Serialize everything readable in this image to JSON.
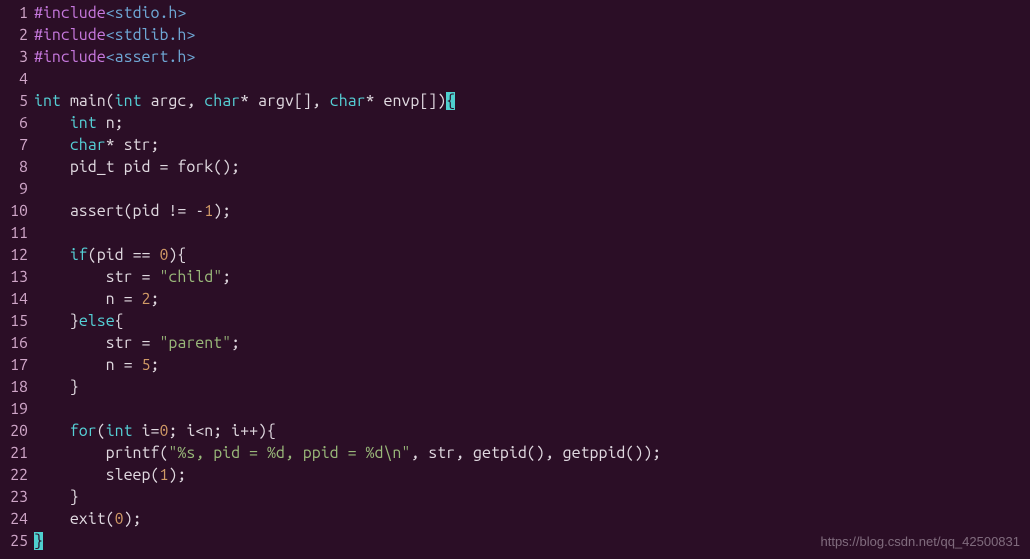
{
  "watermark": "https://blog.csdn.net/qq_42500831",
  "lines": [
    {
      "n": "1",
      "tokens": [
        {
          "t": "#include",
          "c": "pp"
        },
        {
          "t": "<stdio.h>",
          "c": "hdr"
        }
      ]
    },
    {
      "n": "2",
      "tokens": [
        {
          "t": "#include",
          "c": "pp"
        },
        {
          "t": "<stdlib.h>",
          "c": "hdr"
        }
      ]
    },
    {
      "n": "3",
      "tokens": [
        {
          "t": "#include",
          "c": "pp"
        },
        {
          "t": "<assert.h>",
          "c": "hdr"
        }
      ]
    },
    {
      "n": "4",
      "tokens": []
    },
    {
      "n": "5",
      "tokens": [
        {
          "t": "int",
          "c": "kw"
        },
        {
          "t": " main(",
          "c": "id"
        },
        {
          "t": "int",
          "c": "kw"
        },
        {
          "t": " argc, ",
          "c": "id"
        },
        {
          "t": "char",
          "c": "kw"
        },
        {
          "t": "* argv[], ",
          "c": "id"
        },
        {
          "t": "char",
          "c": "kw"
        },
        {
          "t": "* envp[])",
          "c": "id"
        },
        {
          "t": "{",
          "c": "cursor"
        }
      ]
    },
    {
      "n": "6",
      "tokens": [
        {
          "t": "    ",
          "c": "id"
        },
        {
          "t": "int",
          "c": "kw"
        },
        {
          "t": " n;",
          "c": "id"
        }
      ]
    },
    {
      "n": "7",
      "tokens": [
        {
          "t": "    ",
          "c": "id"
        },
        {
          "t": "char",
          "c": "kw"
        },
        {
          "t": "* str;",
          "c": "id"
        }
      ]
    },
    {
      "n": "8",
      "tokens": [
        {
          "t": "    pid_t pid = fork();",
          "c": "id"
        }
      ]
    },
    {
      "n": "9",
      "tokens": []
    },
    {
      "n": "10",
      "tokens": [
        {
          "t": "    assert(pid != -",
          "c": "id"
        },
        {
          "t": "1",
          "c": "num"
        },
        {
          "t": ");",
          "c": "id"
        }
      ]
    },
    {
      "n": "11",
      "tokens": []
    },
    {
      "n": "12",
      "tokens": [
        {
          "t": "    ",
          "c": "id"
        },
        {
          "t": "if",
          "c": "kw"
        },
        {
          "t": "(pid == ",
          "c": "id"
        },
        {
          "t": "0",
          "c": "num"
        },
        {
          "t": "){",
          "c": "id"
        }
      ]
    },
    {
      "n": "13",
      "tokens": [
        {
          "t": "        str = ",
          "c": "id"
        },
        {
          "t": "\"child\"",
          "c": "str"
        },
        {
          "t": ";",
          "c": "id"
        }
      ]
    },
    {
      "n": "14",
      "tokens": [
        {
          "t": "        n = ",
          "c": "id"
        },
        {
          "t": "2",
          "c": "num"
        },
        {
          "t": ";",
          "c": "id"
        }
      ]
    },
    {
      "n": "15",
      "tokens": [
        {
          "t": "    }",
          "c": "id"
        },
        {
          "t": "else",
          "c": "kw"
        },
        {
          "t": "{",
          "c": "id"
        }
      ]
    },
    {
      "n": "16",
      "tokens": [
        {
          "t": "        str = ",
          "c": "id"
        },
        {
          "t": "\"parent\"",
          "c": "str"
        },
        {
          "t": ";",
          "c": "id"
        }
      ]
    },
    {
      "n": "17",
      "tokens": [
        {
          "t": "        n = ",
          "c": "id"
        },
        {
          "t": "5",
          "c": "num"
        },
        {
          "t": ";",
          "c": "id"
        }
      ]
    },
    {
      "n": "18",
      "tokens": [
        {
          "t": "    }",
          "c": "id"
        }
      ]
    },
    {
      "n": "19",
      "tokens": []
    },
    {
      "n": "20",
      "tokens": [
        {
          "t": "    ",
          "c": "id"
        },
        {
          "t": "for",
          "c": "kw"
        },
        {
          "t": "(",
          "c": "id"
        },
        {
          "t": "int",
          "c": "kw"
        },
        {
          "t": " i=",
          "c": "id"
        },
        {
          "t": "0",
          "c": "num"
        },
        {
          "t": "; i<n; i++){",
          "c": "id"
        }
      ]
    },
    {
      "n": "21",
      "tokens": [
        {
          "t": "        printf(",
          "c": "id"
        },
        {
          "t": "\"%s, pid = %d, ppid = %d\\n\"",
          "c": "str"
        },
        {
          "t": ", str, getpid(), getppid());",
          "c": "id"
        }
      ]
    },
    {
      "n": "22",
      "tokens": [
        {
          "t": "        sleep(",
          "c": "id"
        },
        {
          "t": "1",
          "c": "num"
        },
        {
          "t": ");",
          "c": "id"
        }
      ]
    },
    {
      "n": "23",
      "tokens": [
        {
          "t": "    }",
          "c": "id"
        }
      ]
    },
    {
      "n": "24",
      "tokens": [
        {
          "t": "    exit(",
          "c": "id"
        },
        {
          "t": "0",
          "c": "num"
        },
        {
          "t": ");",
          "c": "id"
        }
      ]
    },
    {
      "n": "25",
      "tokens": [
        {
          "t": "}",
          "c": "cursor"
        }
      ]
    }
  ]
}
